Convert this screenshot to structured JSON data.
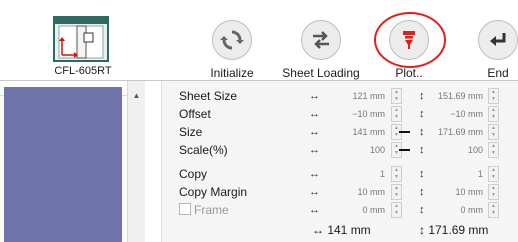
{
  "toolbar": {
    "device_label": "CFL-605RT",
    "buttons": [
      {
        "label": "Initialize",
        "icon": "refresh-icon"
      },
      {
        "label": "Sheet Loading",
        "icon": "swap-arrows-icon"
      },
      {
        "label": "Plot..",
        "icon": "plotter-icon",
        "highlighted": true
      },
      {
        "label": "End",
        "icon": "return-arrow-icon"
      }
    ],
    "highlight_color": "#e0201a",
    "plot_icon_color": "#e0201a"
  },
  "left_panel": {
    "fill_color": "#6f74aa"
  },
  "settings": {
    "rows": [
      {
        "name": "Sheet Size",
        "h_value": "121 mm",
        "v_value": "151.69 mm"
      },
      {
        "name": "Offset",
        "h_value": "−10 mm",
        "v_value": "−10 mm"
      },
      {
        "name": "Size",
        "h_value": "141 mm",
        "v_value": "171.69 mm",
        "linked": true
      },
      {
        "name": "Scale(%)",
        "h_value": "100",
        "v_value": "100",
        "linked": true
      },
      {
        "name": "Copy",
        "h_value": "1",
        "v_value": "1"
      },
      {
        "name": "Copy Margin",
        "h_value": "10 mm",
        "v_value": "10 mm"
      },
      {
        "name": "Frame",
        "h_value": "0 mm",
        "v_value": "0 mm",
        "disabled": true,
        "checkbox": true
      }
    ],
    "totals": {
      "h": "↔ 141 mm",
      "v": "↕ 171.69 mm"
    },
    "h_arrow": "↔",
    "v_arrow": "↕"
  }
}
